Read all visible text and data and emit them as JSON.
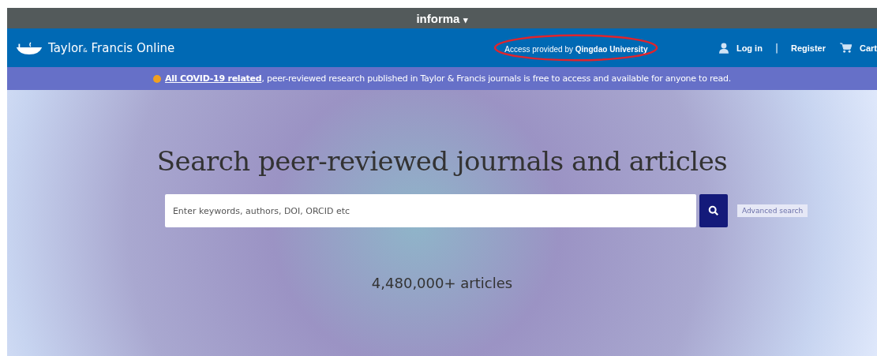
{
  "top_bar": {
    "brand": "informa",
    "caret": "▾"
  },
  "header": {
    "logo_text": "Taylor",
    "logo_amp": "&",
    "logo_rest": " Francis Online",
    "access_text": "Access provided by **Qingdao University**",
    "annotation_circled": true,
    "login": "Log in",
    "separator": "|",
    "register": "Register",
    "cart": "Cart"
  },
  "banner": {
    "link": "All COVID-19 related",
    "text": ", peer-reviewed research published in Taylor & Francis journals is free to access and available for anyone to read."
  },
  "hero": {
    "heading": "Search peer-reviewed journals and articles",
    "search": {
      "placeholder": "Enter keywords, authors, DOI, ORCID etc"
    },
    "advanced_search": "Advanced search",
    "count": "4,480,000+ articles"
  }
}
